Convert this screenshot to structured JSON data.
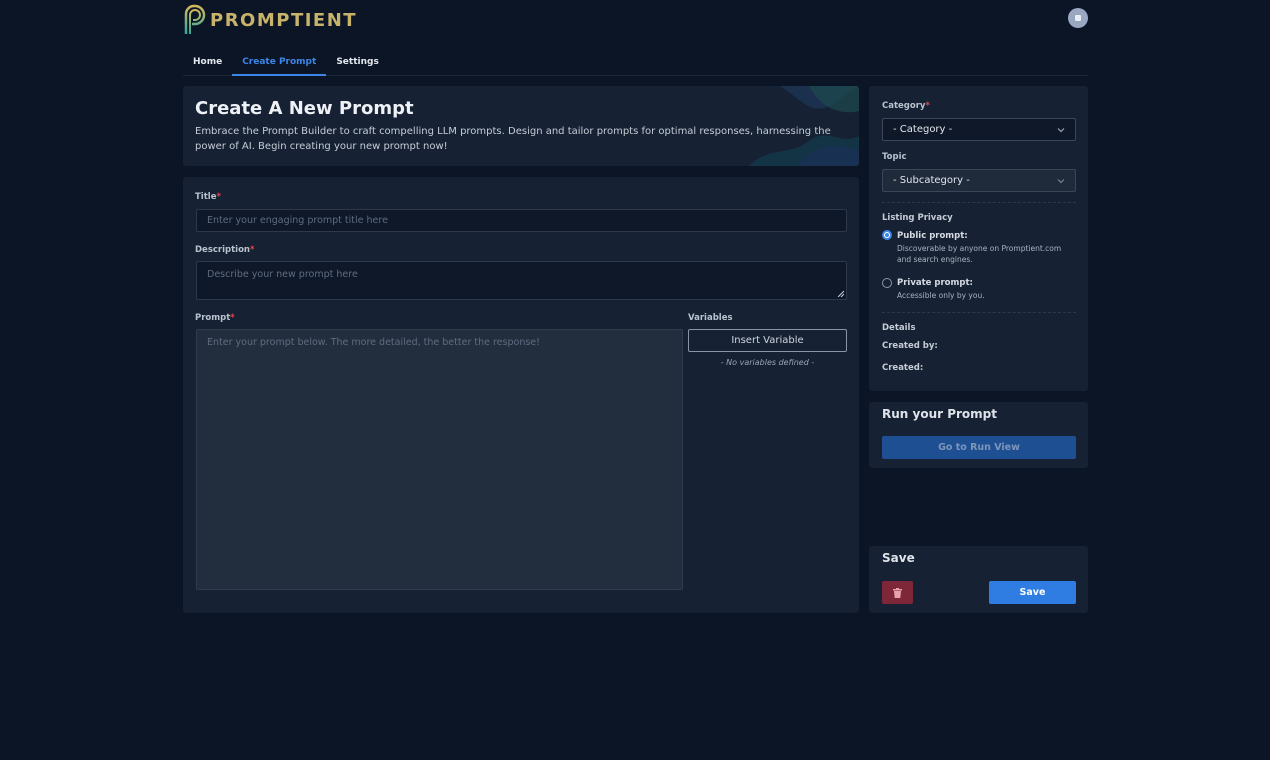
{
  "brand": {
    "name": "PROMPTIENT",
    "logo_icon": "p-logo-icon",
    "color": "#c8b36a"
  },
  "nav": {
    "tabs": [
      {
        "label": "Home"
      },
      {
        "label": "Create Prompt",
        "active": true
      },
      {
        "label": "Settings"
      }
    ]
  },
  "hero": {
    "title": "Create A New Prompt",
    "description": "Embrace the Prompt Builder to craft compelling LLM prompts. Design and tailor prompts for optimal responses, harnessing the power of AI. Begin creating your new prompt now!"
  },
  "form": {
    "title_label": "Title",
    "title_placeholder": "Enter your engaging prompt title here",
    "description_label": "Description",
    "description_placeholder": "Describe your new prompt here",
    "prompt_label": "Prompt",
    "prompt_placeholder": "Enter your prompt below. The more detailed, the better the response!",
    "variables_label": "Variables",
    "insert_variable_label": "Insert Variable",
    "no_variables_text": "- No variables defined -",
    "required_marker": "*"
  },
  "sidebar": {
    "category_label": "Category",
    "category_value": "- Category -",
    "topic_label": "Topic",
    "topic_value": "- Subcategory -",
    "privacy_label": "Listing Privacy",
    "public_title": "Public prompt:",
    "public_desc": "Discoverable by anyone on Promptient.com and search engines.",
    "private_title": "Private prompt:",
    "private_desc": "Accessible only by you.",
    "details_label": "Details",
    "created_by_label": "Created by:",
    "created_label": "Created:",
    "selected_privacy": "public"
  },
  "run": {
    "title": "Run your Prompt",
    "button_label": "Go to Run View"
  },
  "save": {
    "title": "Save",
    "button_label": "Save",
    "delete_icon": "trash-icon"
  },
  "colors": {
    "accent": "#3d86e8",
    "background": "#0b1525",
    "card": "#162133",
    "danger": "#7e2739",
    "required": "#e5484d"
  }
}
